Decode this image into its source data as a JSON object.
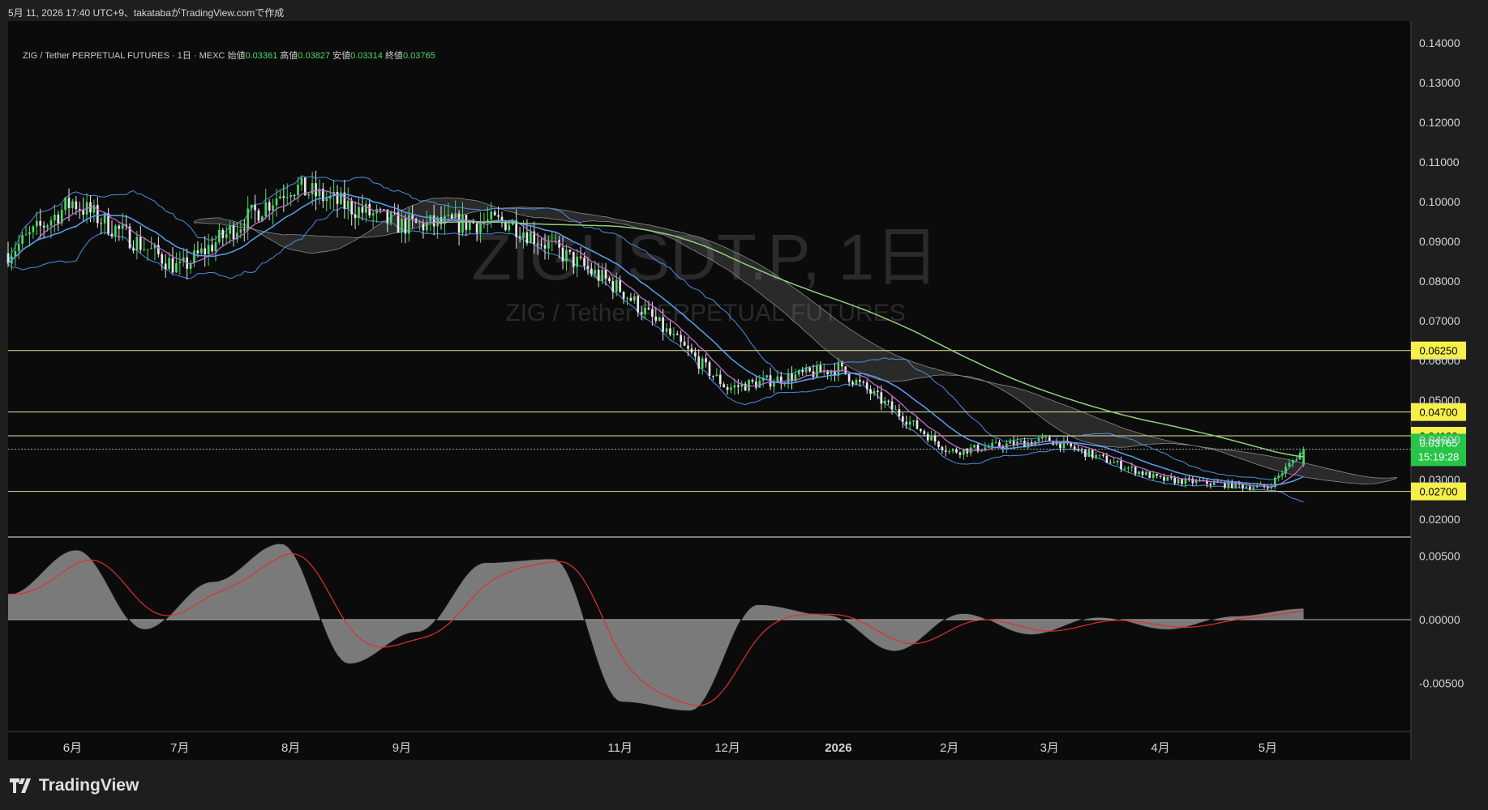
{
  "header": {
    "text": "5月 11, 2026 17:40 UTC+9、takatabaがTradingView.comで作成"
  },
  "symbol_info": {
    "title": "ZIG / Tether PERPETUAL FUTURES · 1日 · MEXC",
    "open_label": "始値",
    "open": "0.03361",
    "high_label": "高値",
    "high": "0.03827",
    "low_label": "安値",
    "low": "0.03314",
    "close_label": "終値",
    "close": "0.03765"
  },
  "watermark": {
    "line1": "ZIGUSDT.P, 1日",
    "line2": "ZIG / Tether PERPETUAL FUTURES"
  },
  "footer": {
    "brand": "TradingView"
  },
  "colors": {
    "up": "#4cd964",
    "down": "#e8e8e8",
    "bb": "#4a8fe0",
    "ma_short": "#c06ad0",
    "ma_mid": "#5aa0f0",
    "ma_long": "#8fd17a",
    "cloud": "#9a9a9a",
    "level": "#e8e39a",
    "macd_signal": "#e03030"
  },
  "chart_data": [
    {
      "type": "candlestick",
      "title": "ZIGUSDT.P, 1日",
      "x_labels": [
        "6月",
        "7月",
        "8月",
        "9月",
        "11月",
        "12月",
        "2026",
        "2月",
        "3月",
        "4月",
        "5月"
      ],
      "y_ticks": [
        "0.14000",
        "0.13000",
        "0.12000",
        "0.11000",
        "0.10000",
        "0.09000",
        "0.08000",
        "0.07000",
        "0.06000",
        "0.05000",
        "0.04000",
        "0.03000",
        "0.02000"
      ],
      "ylim": [
        0.0155,
        0.1455
      ],
      "horizontal_levels": [
        {
          "label": "0.06250",
          "value": 0.0625
        },
        {
          "label": "0.04700",
          "value": 0.047
        },
        {
          "label": "0.04100",
          "value": 0.041
        },
        {
          "label": "0.02700",
          "value": 0.027
        }
      ],
      "current_price": {
        "label": "0.03765",
        "value": 0.03765,
        "countdown": "15:19:28"
      },
      "price_path": {
        "months": [
          "2025-05-14",
          "2025-06-01",
          "2025-07-01",
          "2025-08-01",
          "2025-09-01",
          "2025-10-01",
          "2025-11-01",
          "2025-12-01",
          "2026-01-01",
          "2026-02-01",
          "2026-03-01",
          "2026-04-01",
          "2026-05-01",
          "2026-05-11"
        ],
        "close": [
          0.087,
          0.1,
          0.083,
          0.104,
          0.094,
          0.095,
          0.078,
          0.053,
          0.058,
          0.037,
          0.04,
          0.03,
          0.028,
          0.03765
        ]
      },
      "ohlc_last": {
        "open": 0.03361,
        "high": 0.03827,
        "low": 0.03314,
        "close": 0.03765
      }
    },
    {
      "type": "area",
      "title": "MACD",
      "y_ticks": [
        "0.00500",
        "0.00000",
        "-0.00500"
      ],
      "ylim": [
        -0.0088,
        0.0065
      ],
      "series": [
        {
          "values": [
            0.002,
            0.0055,
            -0.0008,
            0.003,
            0.006,
            -0.0035,
            -0.001,
            0.0045,
            0.0048,
            -0.0065,
            -0.0072,
            0.0012,
            0.0004,
            -0.0025,
            0.0005,
            -0.0012,
            0.0002,
            -0.0008,
            0.0003,
            0.0009
          ]
        }
      ]
    }
  ]
}
